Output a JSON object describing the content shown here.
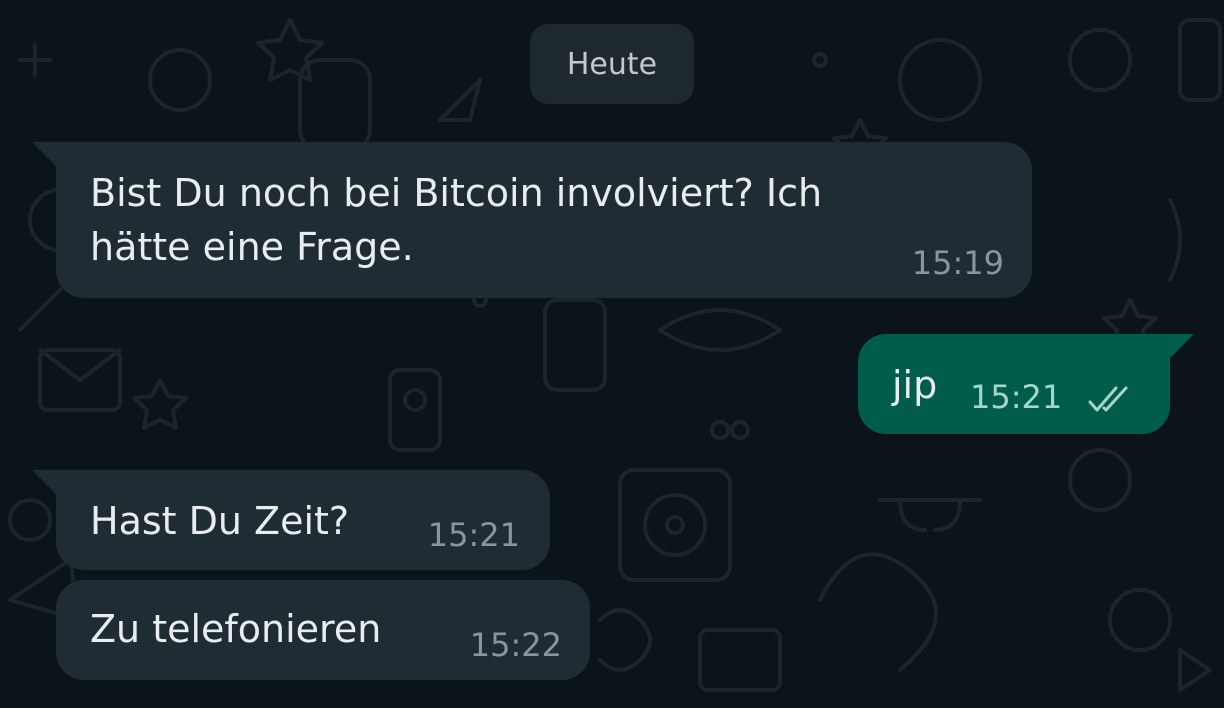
{
  "date_chip": {
    "label": "Heute"
  },
  "messages": [
    {
      "direction": "incoming",
      "line1": "Bist Du noch bei Bitcoin involviert? Ich",
      "line2": "hätte eine Frage.",
      "time": "15:19"
    },
    {
      "direction": "outgoing",
      "text": "jip",
      "time": "15:21",
      "status_icon": "double-check-icon"
    },
    {
      "direction": "incoming",
      "text": "Hast Du Zeit?",
      "time": "15:21"
    },
    {
      "direction": "incoming",
      "text": "Zu telefonieren",
      "time": "15:22"
    }
  ],
  "colors": {
    "background": "#0b141a",
    "incoming_bubble": "#1f2c34",
    "outgoing_bubble": "#005c4b",
    "date_chip": "#1d282f"
  }
}
